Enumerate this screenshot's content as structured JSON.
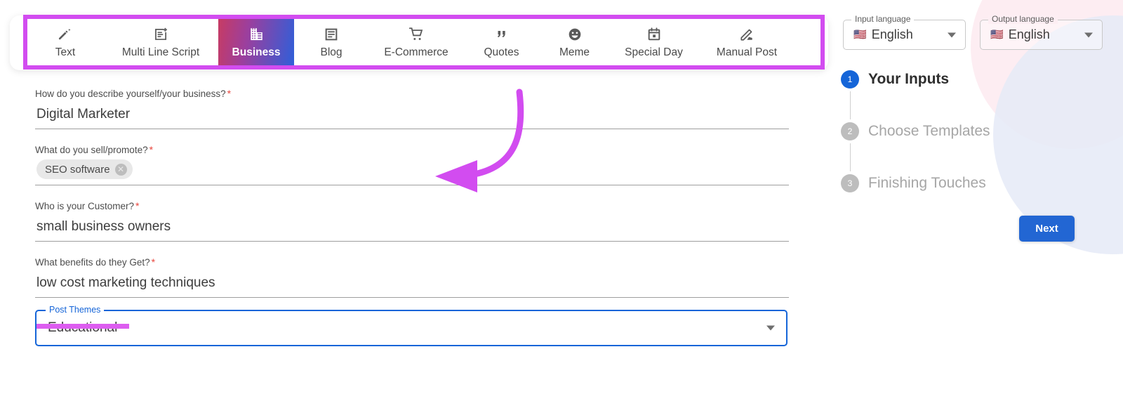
{
  "tabs": [
    {
      "label": "Text",
      "icon": "magic-wand-icon",
      "active": false
    },
    {
      "label": "Multi Line Script",
      "icon": "post-add-icon",
      "active": false
    },
    {
      "label": "Business",
      "icon": "building-icon",
      "active": true
    },
    {
      "label": "Blog",
      "icon": "article-icon",
      "active": false
    },
    {
      "label": "E-Commerce",
      "icon": "shopping-cart-icon",
      "active": false
    },
    {
      "label": "Quotes",
      "icon": "quote-icon",
      "active": false
    },
    {
      "label": "Meme",
      "icon": "smiley-face-icon",
      "active": false
    },
    {
      "label": "Special Day",
      "icon": "calendar-icon",
      "active": false
    },
    {
      "label": "Manual Post",
      "icon": "pencil-edit-icon",
      "active": false
    }
  ],
  "form": {
    "business_description": {
      "label": "How do you describe yourself/your business?",
      "required_marker": "*",
      "value": "Digital Marketer"
    },
    "sell_promote": {
      "label": "What do you sell/promote?",
      "required_marker": "*",
      "chips": [
        {
          "text": "SEO software",
          "remove_glyph": "✕"
        }
      ]
    },
    "customer": {
      "label": "Who is your Customer?",
      "required_marker": "*",
      "value": "small business owners"
    },
    "benefits": {
      "label": "What benefits do they Get?",
      "required_marker": "*",
      "value": "low cost marketing techniques"
    },
    "post_themes": {
      "label": "Post Themes",
      "value": "Educational"
    }
  },
  "languages": {
    "input": {
      "label": "Input language",
      "flag": "🇺🇸",
      "value": "English"
    },
    "output": {
      "label": "Output language",
      "flag": "🇺🇸",
      "value": "English"
    }
  },
  "stepper": {
    "steps": [
      {
        "number": "1",
        "label": "Your Inputs",
        "state": "active"
      },
      {
        "number": "2",
        "label": "Choose Templates",
        "state": "inactive"
      },
      {
        "number": "3",
        "label": "Finishing Touches",
        "state": "inactive"
      }
    ]
  },
  "actions": {
    "next_label": "Next"
  },
  "colors": {
    "accent_blue": "#1565d8",
    "next_button": "#2266d3",
    "annotation_magenta": "#d24cf0",
    "annotation_bar": "#dd5df0",
    "required_red": "#e8453c",
    "active_tab_gradient_start": "#c73b63",
    "active_tab_gradient_end": "#2f5fd9",
    "deco_circle_pink": "#fdeaf0",
    "deco_circle_blue": "#e5eaf7"
  }
}
